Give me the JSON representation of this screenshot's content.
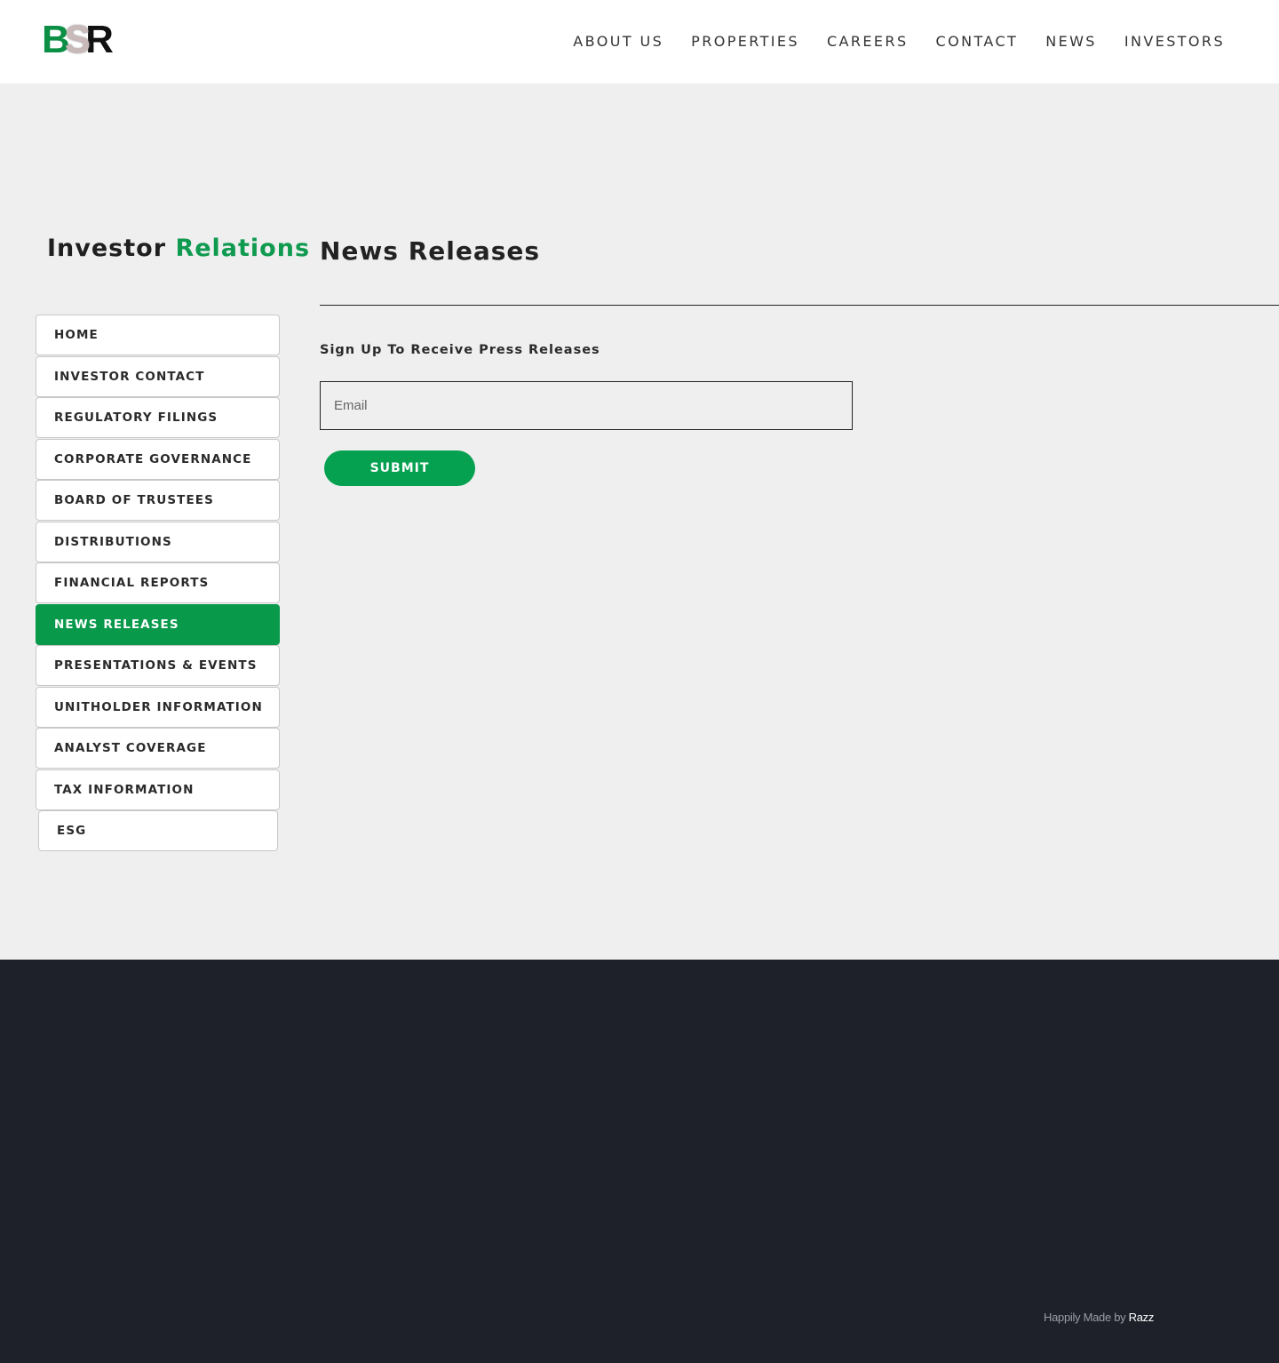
{
  "header": {
    "logo": {
      "letters": [
        "B",
        "S",
        "R"
      ]
    },
    "nav": [
      "ABOUT US",
      "PROPERTIES",
      "CAREERS",
      "CONTACT",
      "NEWS",
      "INVESTORS"
    ]
  },
  "sidebar": {
    "title_part1": "Investor",
    "title_part2": "Relations",
    "items": [
      {
        "label": "HOME"
      },
      {
        "label": "INVESTOR CONTACT"
      },
      {
        "label": "REGULATORY FILINGS"
      },
      {
        "label": "CORPORATE GOVERNANCE"
      },
      {
        "label": "BOARD OF TRUSTEES"
      },
      {
        "label": "DISTRIBUTIONS"
      },
      {
        "label": "FINANCIAL REPORTS"
      },
      {
        "label": "NEWS RELEASES",
        "active": true
      },
      {
        "label": "PRESENTATIONS & EVENTS"
      },
      {
        "label": "UNITHOLDER INFORMATION"
      },
      {
        "label": "ANALYST COVERAGE"
      },
      {
        "label": "TAX INFORMATION"
      },
      {
        "label": "ESG"
      }
    ]
  },
  "main": {
    "title": "News Releases",
    "signup_label": "Sign Up To Receive Press Releases",
    "email_placeholder": "Email",
    "email_value": "",
    "submit_label": "SUBMIT"
  },
  "footer": {
    "credit_text": "Happily Made by",
    "credit_link": "Razz"
  },
  "colors": {
    "accent": "#08994b",
    "footer_bg": "#1e212a",
    "page_bg": "#efefef"
  }
}
